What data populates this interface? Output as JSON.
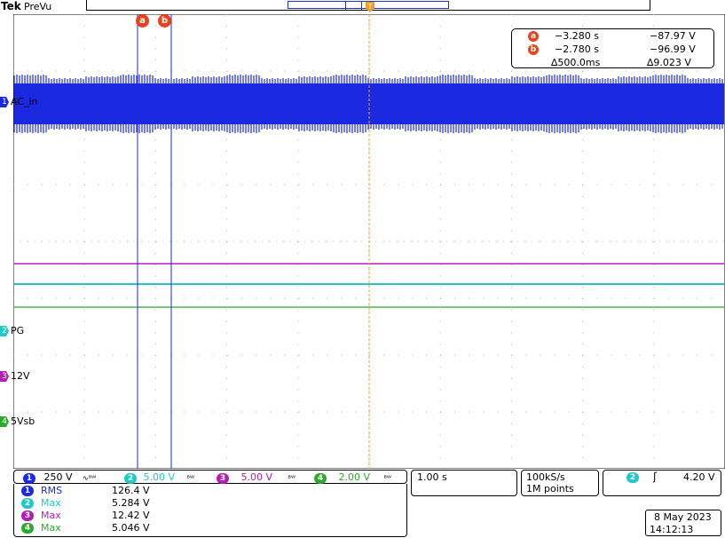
{
  "brand": {
    "name": "Tek",
    "mode": "PreVu"
  },
  "colors": {
    "ch1": "#1b29e0",
    "ch2": "#20c8c8",
    "ch3": "#b020b0",
    "ch4": "#2ca82c",
    "cursor_marker": "#e8431c",
    "trigger": "#f0a020",
    "grid": "#b0b0b0"
  },
  "cursors": {
    "a": {
      "marker": "a",
      "time": "−3.280 s",
      "voltage": "−87.97 V"
    },
    "b": {
      "marker": "b",
      "time": "−2.780 s",
      "voltage": "−96.99 V"
    },
    "delta_time": "∆500.0ms",
    "delta_voltage": "∆9.023 V"
  },
  "channel_labels": [
    {
      "channel": "1",
      "label": "AC_in"
    },
    {
      "channel": "2",
      "label": "PG"
    },
    {
      "channel": "3",
      "label": "12V"
    },
    {
      "channel": "4",
      "label": "5Vsb"
    }
  ],
  "vertical": [
    {
      "channel": "1",
      "scale": "250 V",
      "coupling_icon": "ac-coupling-icon"
    },
    {
      "channel": "2",
      "scale": "5.00 V",
      "coupling_icon": "bandwidth-icon"
    },
    {
      "channel": "3",
      "scale": "5.00 V",
      "coupling_icon": "bandwidth-icon"
    },
    {
      "channel": "4",
      "scale": "2.00 V",
      "coupling_icon": "bandwidth-icon"
    }
  ],
  "horizontal": {
    "scale": "1.00 s",
    "sample_rate": "100kS/s",
    "record_length": "1M points"
  },
  "trigger": {
    "channel": "2",
    "slope_icon": "rising-edge-icon",
    "level": "4.20 V"
  },
  "measurements": [
    {
      "channel": "1",
      "name": "RMS",
      "value": "126.4 V"
    },
    {
      "channel": "2",
      "name": "Max",
      "value": "5.284 V"
    },
    {
      "channel": "3",
      "name": "Max",
      "value": "12.42 V"
    },
    {
      "channel": "4",
      "name": "Max",
      "value": "5.046 V"
    }
  ],
  "datetime": {
    "date": "8 May 2023",
    "time": "14:12:13"
  }
}
